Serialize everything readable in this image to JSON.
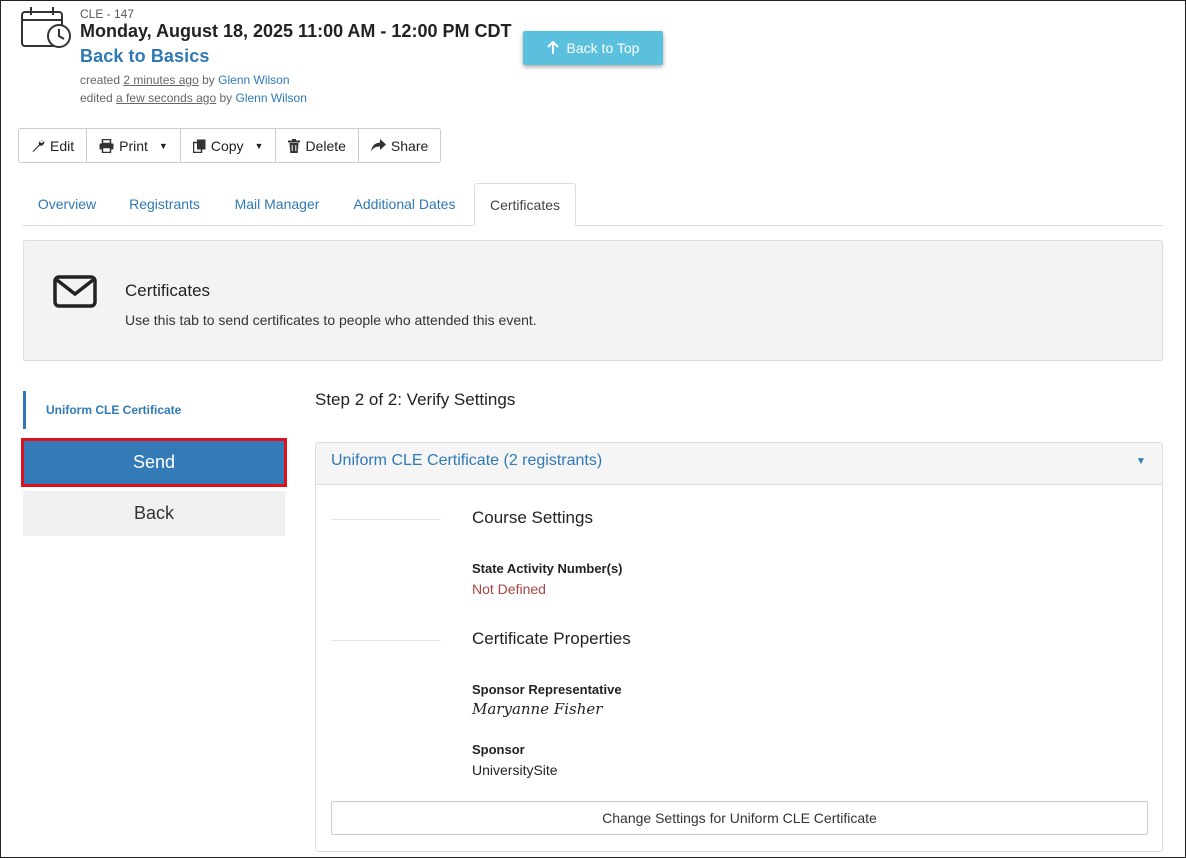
{
  "header": {
    "event_id": "CLE - 147",
    "event_date": "Monday, August 18, 2025 11:00 AM - 12:00 PM CDT",
    "event_title": "Back to Basics",
    "created_prefix": "created",
    "created_time": "2 minutes ago",
    "created_by_word": "by",
    "created_by": "Glenn Wilson",
    "edited_prefix": "edited",
    "edited_time": "a few seconds ago",
    "edited_by_word": "by",
    "edited_by": "Glenn Wilson"
  },
  "back_to_top": "Back to Top",
  "toolbar": {
    "edit": "Edit",
    "print": "Print",
    "copy": "Copy",
    "delete": "Delete",
    "share": "Share"
  },
  "tabs": [
    {
      "label": "Overview"
    },
    {
      "label": "Registrants"
    },
    {
      "label": "Mail Manager"
    },
    {
      "label": "Additional Dates"
    },
    {
      "label": "Certificates"
    }
  ],
  "info_panel": {
    "title": "Certificates",
    "description": "Use this tab to send certificates to people who attended this event."
  },
  "sidebar": {
    "item": "Uniform CLE Certificate",
    "send": "Send",
    "back": "Back"
  },
  "step": {
    "title": "Step 2 of 2: Verify Settings",
    "accordion_title": "Uniform CLE Certificate (2 registrants)",
    "course_settings": {
      "title": "Course Settings",
      "state_activity_label": "State Activity Number(s)",
      "state_activity_value": "Not Defined"
    },
    "certificate_properties": {
      "title": "Certificate Properties",
      "sponsor_rep_label": "Sponsor Representative",
      "sponsor_rep_signature": "Maryanne Fisher",
      "sponsor_label": "Sponsor",
      "sponsor_value": "UniversitySite"
    },
    "change_button": "Change Settings for Uniform CLE Certificate"
  },
  "colors": {
    "link": "#2f79b5",
    "primary_button": "#337ab7",
    "back_to_top": "#5bc0de",
    "highlight": "#e0101a",
    "error_text": "#a94442"
  }
}
